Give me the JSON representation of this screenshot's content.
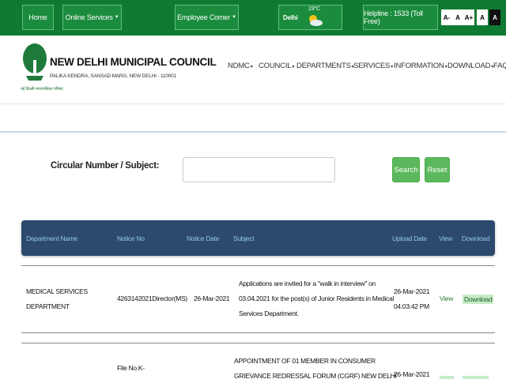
{
  "topbar": {
    "home": "Home",
    "online_services": "Online Services",
    "employee_corner": "Employee Corner",
    "weather_city": "Delhi",
    "weather_temp": "23°C",
    "helpline": "Helpline : 1533 (Toll Free)",
    "font_sizes": [
      "A-",
      "A",
      "A+",
      "A",
      "A"
    ]
  },
  "header": {
    "org_name": "NEW DELHI MUNICIPAL COUNCIL",
    "org_address": "PALIKA KENDRA, SANSAD MARG, NEW DELHI - 110001",
    "logo_subtext": "नई दिल्ली नगरपालिका परिषद",
    "nav": [
      {
        "label": "NDMC"
      },
      {
        "label": "COUNCIL"
      },
      {
        "label": "DEPARTMENTS"
      },
      {
        "label": "SERVICES"
      },
      {
        "label": "INFORMATION"
      },
      {
        "label": "DOWNLOAD"
      },
      {
        "label": "FAQ"
      }
    ]
  },
  "search": {
    "label": "Circular Number / Subject:",
    "value": "",
    "placeholder": "",
    "search_button": "Search",
    "reset_button": "Reset"
  },
  "table": {
    "headers": [
      "Department Name",
      "Notice No",
      "Notice Date",
      "Subject",
      "Upload Date",
      "View",
      "Download"
    ],
    "rows": [
      {
        "department": [
          "MEDICAL SERVICES",
          "DEPARTMENT"
        ],
        "notice_no": "4263142021Director(MS)",
        "notice_date": "26-Mar-2021",
        "subject": [
          "Applications are invited for a \"walk in interview\" on",
          "03.04.2021 for the post(s) of Junior Residents in Medical",
          "Services Department."
        ],
        "upload_date": [
          "26-Mar-2021",
          "04:03:42 PM"
        ],
        "view": "View",
        "download": "Download"
      },
      {
        "department": [
          ""
        ],
        "notice_no": "File No.K-",
        "notice_date": "",
        "subject": [
          "APPOINTMENT OF 01 MEMBER IN CONSUMER",
          "GRIEVANCE REDRESSAL FORUM (CGRF) NEW DELHI"
        ],
        "upload_date": [
          "26-Mar-2021"
        ],
        "view": "",
        "download": ""
      }
    ]
  },
  "colors": {
    "topbar_green": "#0f7a32",
    "table_header": "#2d4a6e",
    "button_green": "#5cb85c"
  }
}
